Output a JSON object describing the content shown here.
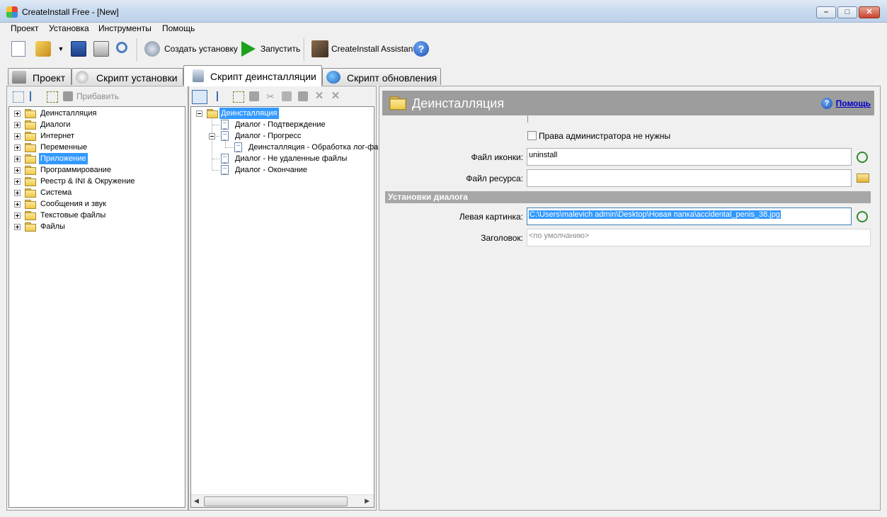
{
  "window": {
    "title": "CreateInstall Free - [New]"
  },
  "menu": {
    "items": [
      "Проект",
      "Установка",
      "Инструменты",
      "Помощь"
    ]
  },
  "toolbar": {
    "create_setup_label": "Создать установку",
    "run_label": "Запустить",
    "assistant_label": "CreateInstall Assistant"
  },
  "tabs": [
    {
      "label": "Проект"
    },
    {
      "label": "Скрипт установки"
    },
    {
      "label": "Скрипт деинсталляции",
      "active": true
    },
    {
      "label": "Скрипт обновления"
    }
  ],
  "left_panel": {
    "add_label": "Прибавить",
    "items": [
      "Деинсталляция",
      "Диалоги",
      "Интернет",
      "Переменные",
      "Приложение",
      "Программирование",
      "Реестр & INI & Окружение",
      "Система",
      "Сообщения и звук",
      "Текстовые файлы",
      "Файлы"
    ],
    "selected_item": "Приложение"
  },
  "script_tree": {
    "root": "Деинсталляция",
    "items": [
      "Диалог - Подтверждение",
      "Диалог - Прогресс",
      "Деинсталляция - Обработка лог-фа",
      "Диалог - Не удаленные файлы",
      "Диалог - Окончание"
    ]
  },
  "properties": {
    "title": "Деинсталляция",
    "help_label": "Помощь",
    "admin_checkbox_label": "Права администратора не нужны",
    "admin_checkbox_checked": false,
    "icon_file_label": "Файл иконки:",
    "icon_file_value": "uninstall",
    "resource_file_label": "Файл ресурса:",
    "resource_file_value": "",
    "dialog_section": "Установки диалога",
    "left_image_label": "Левая картинка:",
    "left_image_value": "C:\\Users\\malevich admin\\Desktop\\Новая папка\\accidental_penis_38.jpg",
    "heading_label": "Заголовок:",
    "heading_placeholder": "<по умолчанию>"
  },
  "colors": {
    "selection": "#3399ff",
    "header_bar": "#9d9d9d",
    "link": "#0000cc"
  }
}
